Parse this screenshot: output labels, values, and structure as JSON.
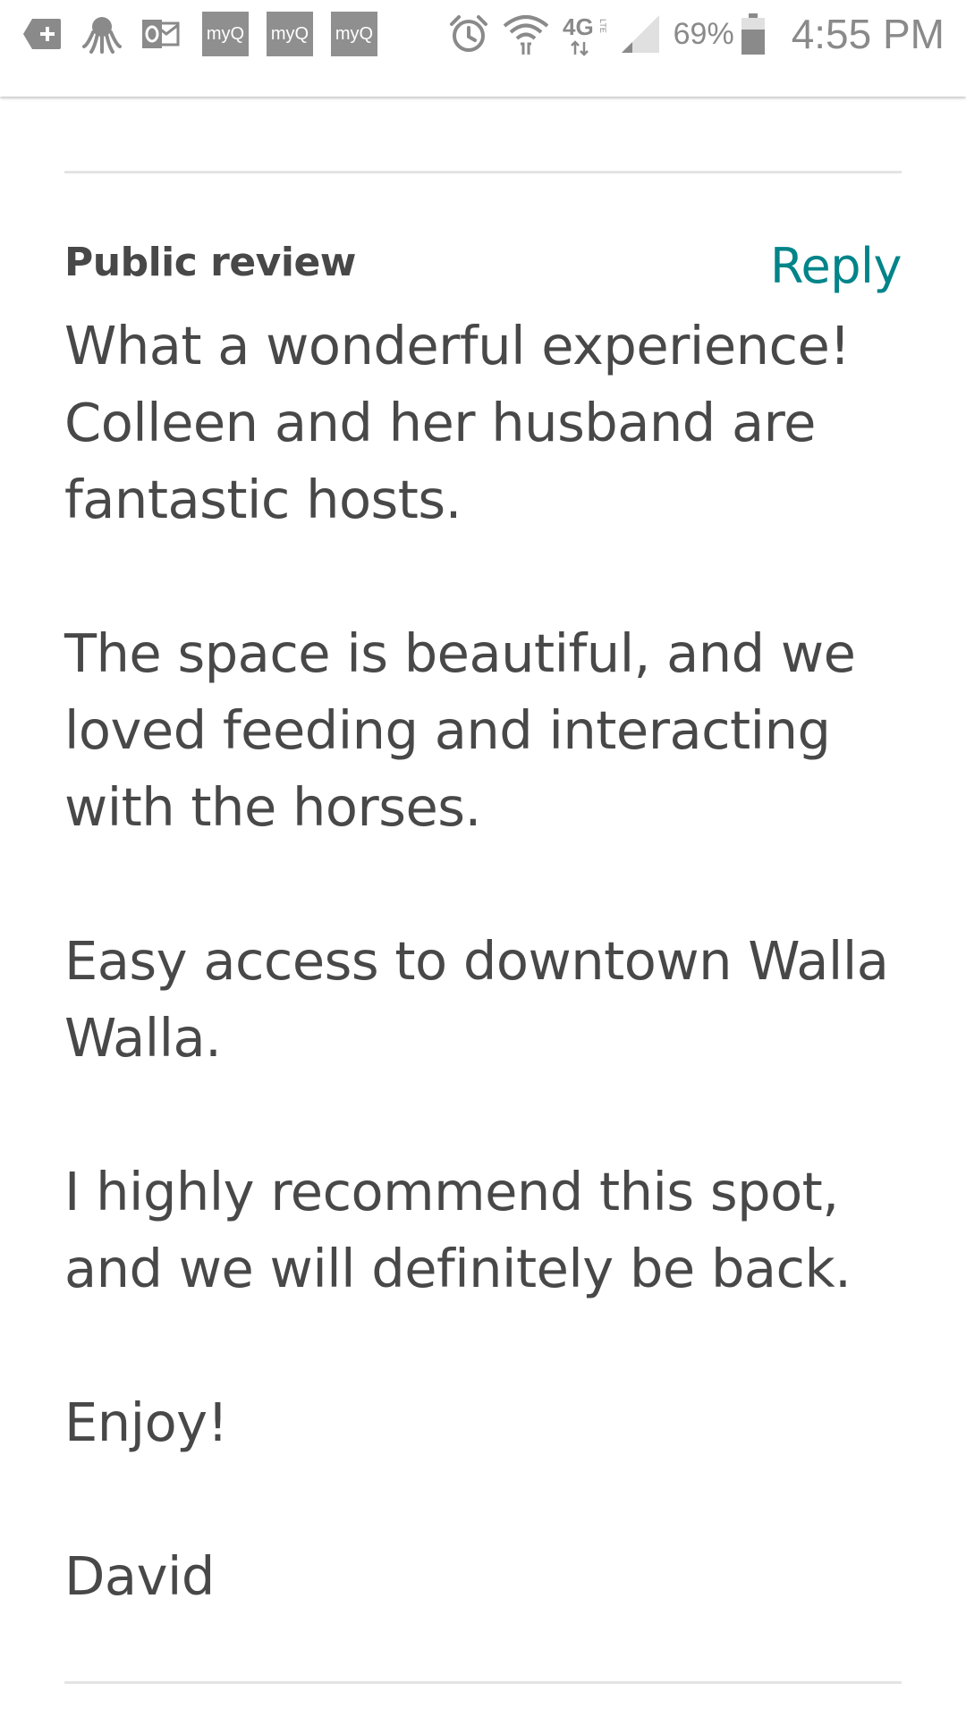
{
  "status_bar": {
    "left_icons": [
      {
        "name": "plus-box-icon",
        "glyph": "+"
      },
      {
        "name": "octopus-icon",
        "glyph": "🐙"
      },
      {
        "name": "outlook-icon",
        "glyph": "o"
      }
    ],
    "myq_labels": [
      "myQ",
      "myQ",
      "myQ"
    ],
    "right_icons": [
      {
        "name": "alarm-icon"
      },
      {
        "name": "wifi-icon"
      },
      {
        "name": "lte-icon",
        "label": "4G"
      },
      {
        "name": "signal-icon"
      }
    ],
    "battery_percent_text": "69%",
    "battery_level": 0.69,
    "time": "4:55 PM"
  },
  "review": {
    "heading": "Public review",
    "reply_label": "Reply",
    "paragraphs": [
      "What a wonderful experience! Colleen and her husband are fantastic hosts.",
      "The space is beautiful, and we loved feeding and interacting with the horses.",
      "Easy access to downtown Walla Walla.",
      "I highly recommend this spot, and we will definitely be back.",
      "Enjoy!",
      "David"
    ]
  },
  "colors": {
    "text": "#484848",
    "accent": "#008489",
    "divider": "#e4e4e4",
    "status_icon": "#8a8a8a"
  }
}
